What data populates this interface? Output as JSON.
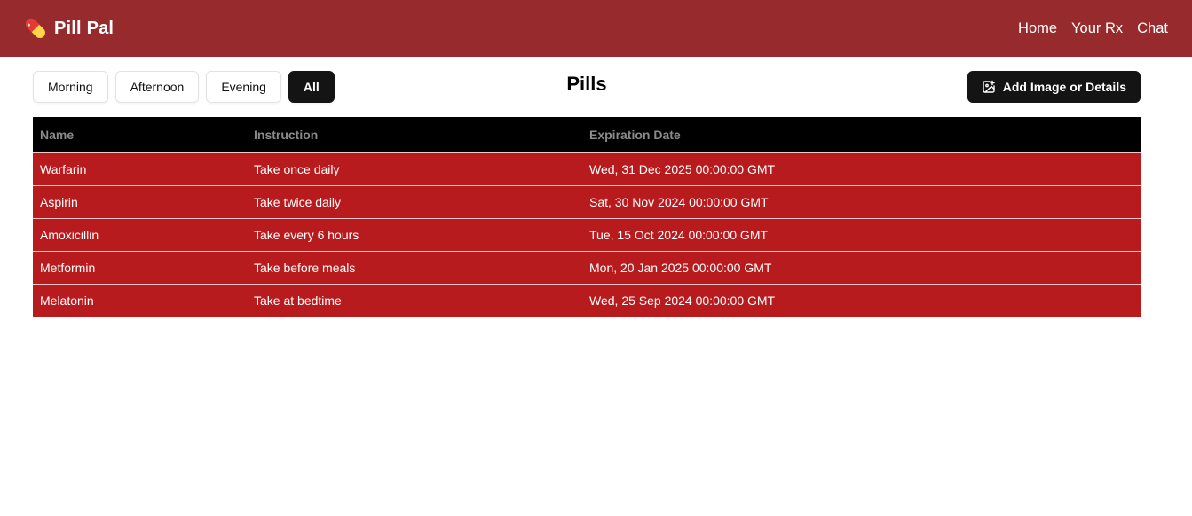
{
  "navbar": {
    "brand": "Pill Pal",
    "links": [
      "Home",
      "Your Rx",
      "Chat"
    ]
  },
  "toolbar": {
    "filters": [
      "Morning",
      "Afternoon",
      "Evening",
      "All"
    ],
    "active_filter": "All",
    "title": "Pills",
    "add_label": "Add Image or Details"
  },
  "table": {
    "headers": [
      "Name",
      "Instruction",
      "Expiration Date"
    ],
    "rows": [
      [
        "Warfarin",
        "Take once daily",
        "Wed, 31 Dec 2025 00:00:00 GMT"
      ],
      [
        "Aspirin",
        "Take twice daily",
        "Sat, 30 Nov 2024 00:00:00 GMT"
      ],
      [
        "Amoxicillin",
        "Take every 6 hours",
        "Tue, 15 Oct 2024 00:00:00 GMT"
      ],
      [
        "Metformin",
        "Take before meals",
        "Mon, 20 Jan 2025 00:00:00 GMT"
      ],
      [
        "Melatonin",
        "Take at bedtime",
        "Wed, 25 Sep 2024 00:00:00 GMT"
      ]
    ]
  },
  "colors": {
    "navbar": "#962a2c",
    "row": "#b81b1e",
    "header": "#000000",
    "button_dark": "#141414"
  },
  "icons": {
    "brand": "pill-icon",
    "add": "image-plus-icon"
  }
}
